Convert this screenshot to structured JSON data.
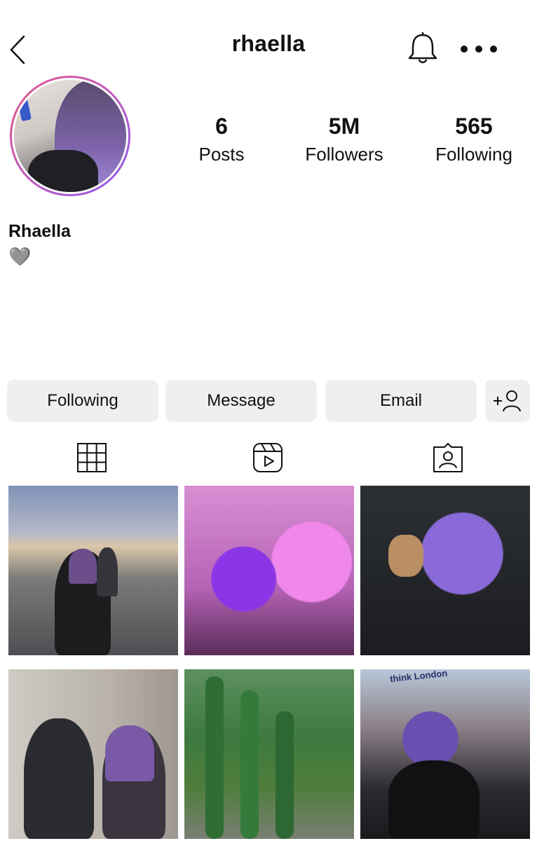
{
  "header": {
    "username": "rhaella",
    "back_icon": "chevron-left-icon",
    "notification_icon": "bell-icon",
    "more_icon": "more-horizontal-icon"
  },
  "profile": {
    "display_name": "Rhaella",
    "bio": "🩶",
    "stats": [
      {
        "value": "6",
        "label": "Posts"
      },
      {
        "value": "5M",
        "label": "Followers"
      },
      {
        "value": "565",
        "label": "Following"
      }
    ],
    "avatar_ring_colors": [
      "#e05a8a",
      "#8d5cf0"
    ]
  },
  "actions": {
    "following_label": "Following",
    "message_label": "Message",
    "email_label": "Email",
    "add_user_icon": "add-user-icon"
  },
  "tabs": [
    {
      "icon": "grid-icon"
    },
    {
      "icon": "reels-icon"
    },
    {
      "icon": "tagged-icon"
    }
  ],
  "posts": [
    {
      "subject": "two people walking on bridge at sunset"
    },
    {
      "subject": "purple and pink hair in pink room"
    },
    {
      "subject": "purple hair holding kitten"
    },
    {
      "subject": "two people near graffiti wall"
    },
    {
      "subject": "cactus plants"
    },
    {
      "subject": "purple-haired person at bus stop",
      "text": "think London"
    }
  ],
  "colors": {
    "button_bg": "#efefef",
    "text": "#111111"
  }
}
